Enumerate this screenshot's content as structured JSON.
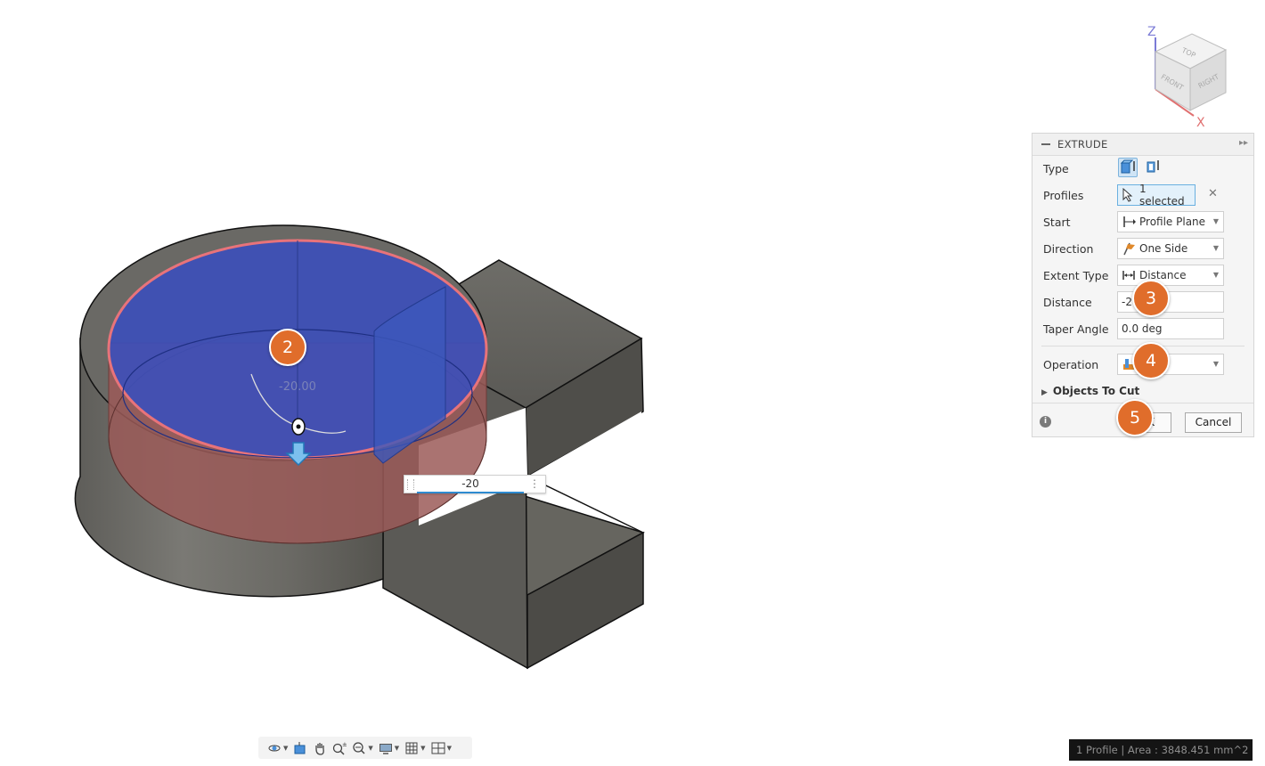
{
  "colors": {
    "accent": "#e06d2b",
    "selection_blue": "#3a55c8",
    "profile_edge": "#e8737a",
    "body_gray": "#6b6a66",
    "panel_bg": "#f5f5f5"
  },
  "viewcube": {
    "axis_z": "Z",
    "axis_x": "X",
    "face_top": "TOP",
    "face_front": "FRONT",
    "face_right": "RIGHT"
  },
  "canvas": {
    "dimension_label": "-20.00",
    "distance_input_value": "-20"
  },
  "extrude_panel": {
    "title": "EXTRUDE",
    "type": {
      "label": "Type",
      "options": [
        "one-side-extrude-icon",
        "thin-extrude-icon"
      ],
      "selected_index": 0
    },
    "profiles": {
      "label": "Profiles",
      "value": "1 selected",
      "clear_icon": "close-icon"
    },
    "start": {
      "label": "Start",
      "value": "Profile Plane",
      "icon": "profile-plane-icon"
    },
    "direction": {
      "label": "Direction",
      "value": "One Side",
      "icon": "one-side-flag-icon"
    },
    "extent_type": {
      "label": "Extent Type",
      "value": "Distance",
      "icon": "distance-icon"
    },
    "distance": {
      "label": "Distance",
      "value": "-2"
    },
    "taper_angle": {
      "label": "Taper Angle",
      "value": "0.0 deg"
    },
    "operation": {
      "label": "Operation",
      "value": "",
      "icon": "cut-operation-icon"
    },
    "objects_to_cut": {
      "label": "Objects To Cut"
    },
    "ok_label": "K",
    "cancel_label": "Cancel"
  },
  "callouts": [
    "2",
    "3",
    "4",
    "5"
  ],
  "toolbar": {
    "tools": [
      "orbit-icon",
      "look-at-icon",
      "pan-icon",
      "zoom-icon",
      "fit-zoom-icon",
      "display-settings-icon",
      "grid-icon",
      "viewports-icon"
    ]
  },
  "status_bar": {
    "text": "1 Profile | Area : 3848.451 mm^2"
  }
}
